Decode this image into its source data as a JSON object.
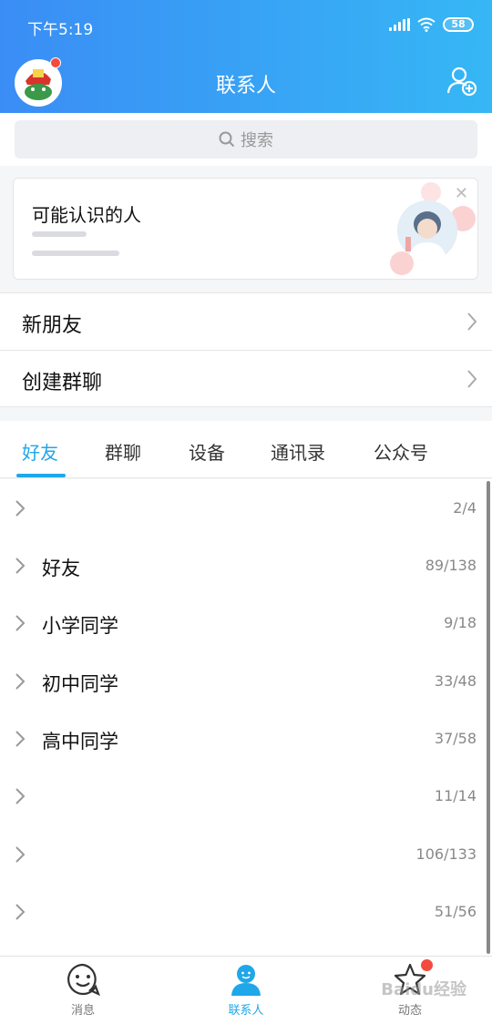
{
  "status_bar": {
    "time": "下午5:19",
    "battery": "58"
  },
  "header": {
    "title": "联系人"
  },
  "search": {
    "placeholder": "搜索"
  },
  "suggestion_card": {
    "title": "可能认识的人"
  },
  "menu": [
    {
      "label": "新朋友"
    },
    {
      "label": "创建群聊"
    }
  ],
  "tabs": [
    {
      "label": "好友",
      "active": true
    },
    {
      "label": "群聊",
      "active": false
    },
    {
      "label": "设备",
      "active": false
    },
    {
      "label": "通讯录",
      "active": false
    },
    {
      "label": "公众号",
      "active": false
    }
  ],
  "groups": [
    {
      "name": "",
      "count": "2/4"
    },
    {
      "name": "好友",
      "count": "89/138"
    },
    {
      "name": "小学同学",
      "count": "9/18"
    },
    {
      "name": "初中同学",
      "count": "33/48"
    },
    {
      "name": "高中同学",
      "count": "37/58"
    },
    {
      "name": "",
      "count": "11/14"
    },
    {
      "name": "",
      "count": "106/133"
    },
    {
      "name": "",
      "count": "51/56"
    }
  ],
  "bottom_nav": [
    {
      "label": "消息",
      "icon": "smiley-icon",
      "active": false
    },
    {
      "label": "联系人",
      "icon": "contact-person-icon",
      "active": true
    },
    {
      "label": "动态",
      "icon": "star-icon",
      "active": false
    }
  ],
  "watermark": "Baidu经验",
  "colors": {
    "accent": "#1fa7ea",
    "header_start": "#3a8df5",
    "header_end": "#36b7f5",
    "badge": "#f34a3e"
  }
}
